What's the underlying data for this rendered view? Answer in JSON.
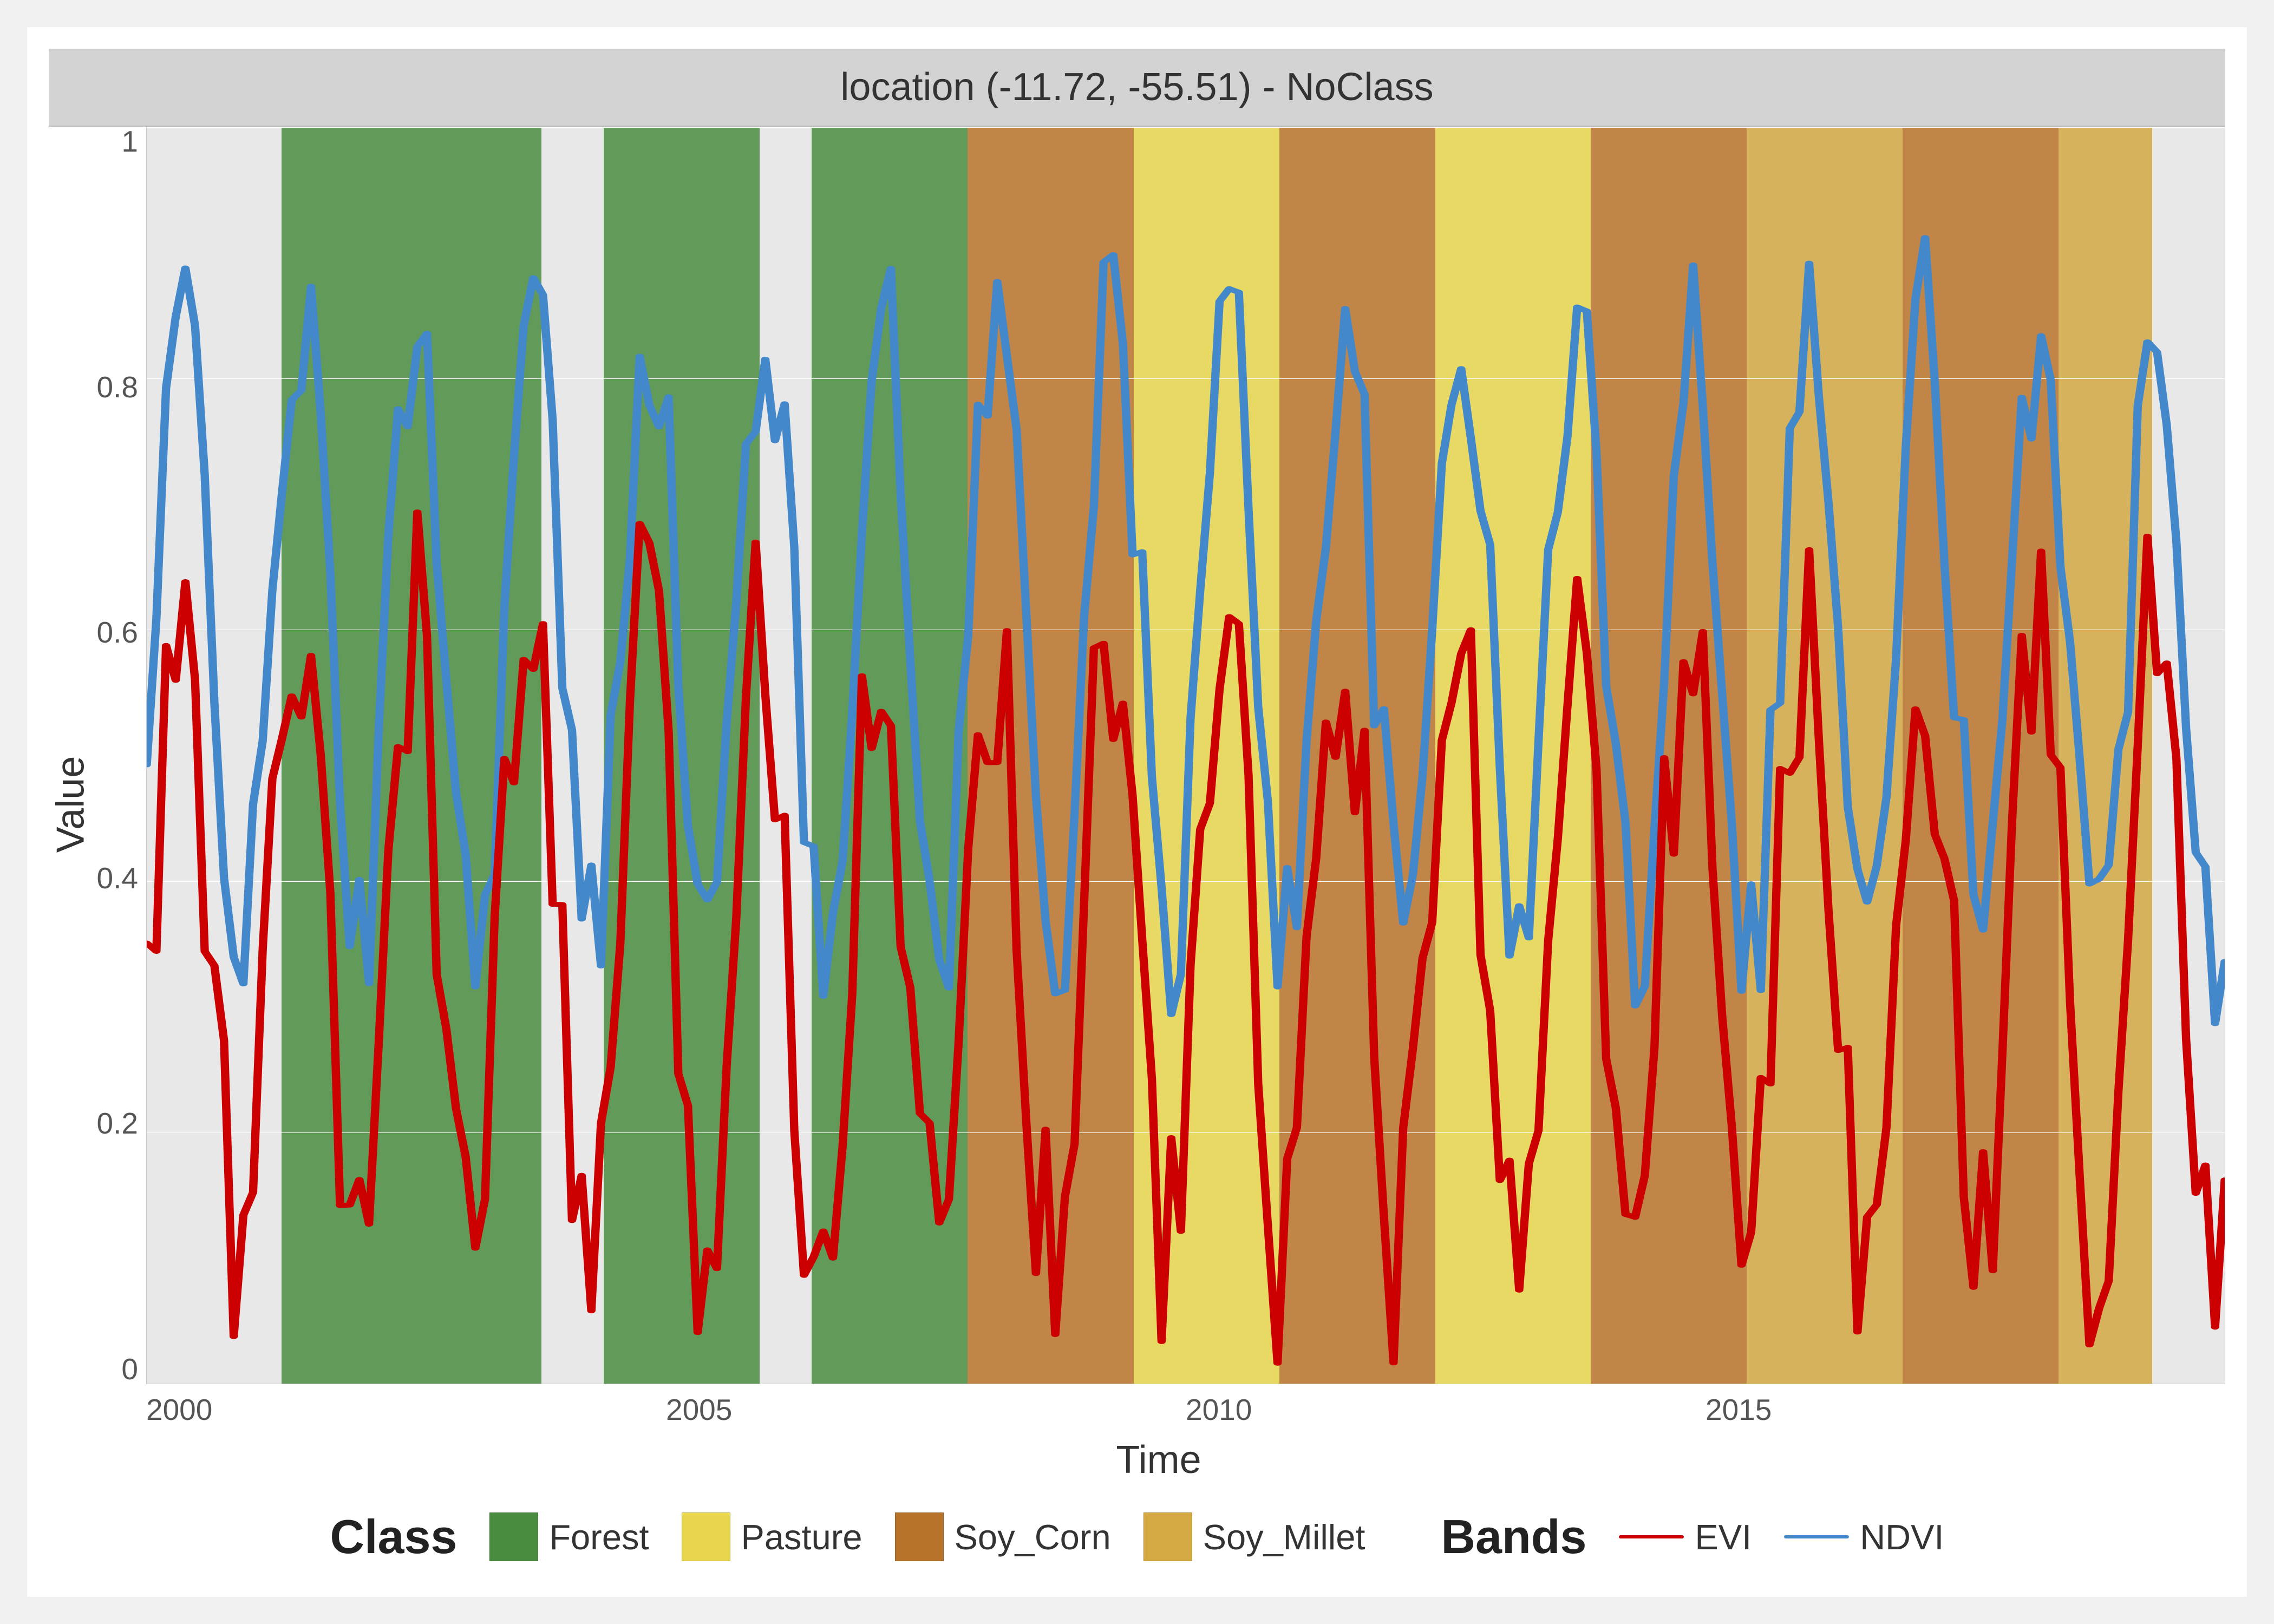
{
  "title": "location (-11.72, -55.51) - NoClass",
  "yAxis": {
    "label": "Value",
    "ticks": [
      "1",
      "0.8",
      "0.6",
      "0.4",
      "0.2",
      "0"
    ]
  },
  "xAxis": {
    "label": "Time",
    "ticks": [
      "2000",
      "2005",
      "2010",
      "2015"
    ]
  },
  "legend": {
    "class_title": "Class",
    "bands_title": "Bands",
    "class_items": [
      {
        "label": "Forest",
        "color": "#4a8c3f"
      },
      {
        "label": "Pasture",
        "color": "#e8d64e"
      },
      {
        "label": "Soy_Corn",
        "color": "#b8732a"
      },
      {
        "label": "Soy_Millet",
        "color": "#d4a843"
      }
    ],
    "band_items": [
      {
        "label": "EVI",
        "color": "#cc0000"
      },
      {
        "label": "NDVI",
        "color": "#4488cc"
      }
    ]
  },
  "bands": [
    {
      "start": 0.0,
      "end": 0.065,
      "color": "#e8e8e8",
      "class": "NoClass"
    },
    {
      "start": 0.065,
      "end": 0.19,
      "color": "#4a8c3f",
      "class": "Forest"
    },
    {
      "start": 0.19,
      "end": 0.22,
      "color": "#e8e8e8",
      "class": "gap"
    },
    {
      "start": 0.22,
      "end": 0.295,
      "color": "#4a8c3f",
      "class": "Forest"
    },
    {
      "start": 0.295,
      "end": 0.32,
      "color": "#e8e8e8",
      "class": "gap"
    },
    {
      "start": 0.32,
      "end": 0.395,
      "color": "#4a8c3f",
      "class": "Forest"
    },
    {
      "start": 0.395,
      "end": 0.475,
      "color": "#b8732a",
      "class": "Soy_Corn"
    },
    {
      "start": 0.475,
      "end": 0.545,
      "color": "#e8d64e",
      "class": "Pasture"
    },
    {
      "start": 0.545,
      "end": 0.62,
      "color": "#b8732a",
      "class": "Soy_Corn"
    },
    {
      "start": 0.62,
      "end": 0.695,
      "color": "#e8d64e",
      "class": "Pasture"
    },
    {
      "start": 0.695,
      "end": 0.77,
      "color": "#b8732a",
      "class": "Soy_Corn"
    },
    {
      "start": 0.77,
      "end": 0.845,
      "color": "#d4a843",
      "class": "Soy_Millet"
    },
    {
      "start": 0.845,
      "end": 0.92,
      "color": "#b8732a",
      "class": "Soy_Corn"
    },
    {
      "start": 0.92,
      "end": 0.965,
      "color": "#d4a843",
      "class": "Soy_Millet"
    },
    {
      "start": 0.965,
      "end": 1.0,
      "color": "#e8e8e8",
      "class": "gap"
    }
  ]
}
